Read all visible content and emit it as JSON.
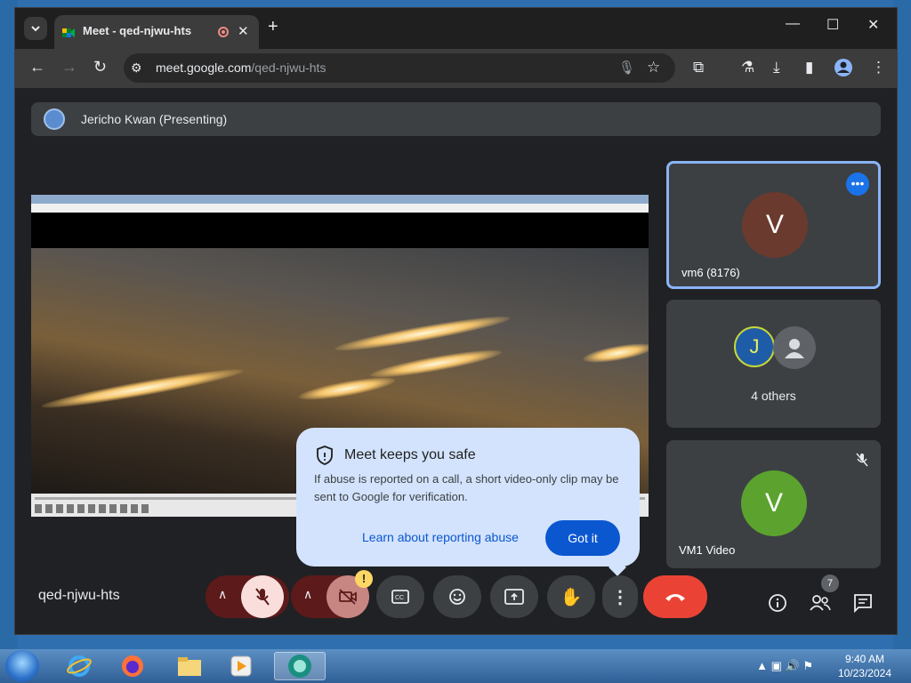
{
  "browser": {
    "tab_title": "Meet - qed-njwu-hts",
    "tab_close": "✕",
    "new_tab": "+",
    "url_host": "meet.google.com",
    "url_path": "/qed-njwu-hts",
    "win_minimize": "—",
    "win_maximize": "☐",
    "win_close": "✕"
  },
  "meet": {
    "presenter_label": "Jericho Kwan (Presenting)",
    "tiles": [
      {
        "name": "vm6 (8176)",
        "initial": "V",
        "avatar_color": "#6b3a2e"
      },
      {
        "others_label": "4 others",
        "badge_letter": "J"
      },
      {
        "name": "VM1 Video",
        "initial": "V",
        "avatar_color": "#5ba32e"
      }
    ],
    "more_options": "•••",
    "popup": {
      "title": "Meet keeps you safe",
      "body": "If abuse is reported on a call, a short video-only clip may be sent to Google for verification.",
      "link": "Learn about reporting abuse",
      "button": "Got it"
    },
    "meeting_code": "qed-njwu-hts",
    "camera_warning": "!",
    "people_count": "7",
    "accent": "#0b57d0"
  },
  "taskbar": {
    "time": "9:40 AM",
    "date": "10/23/2024"
  }
}
